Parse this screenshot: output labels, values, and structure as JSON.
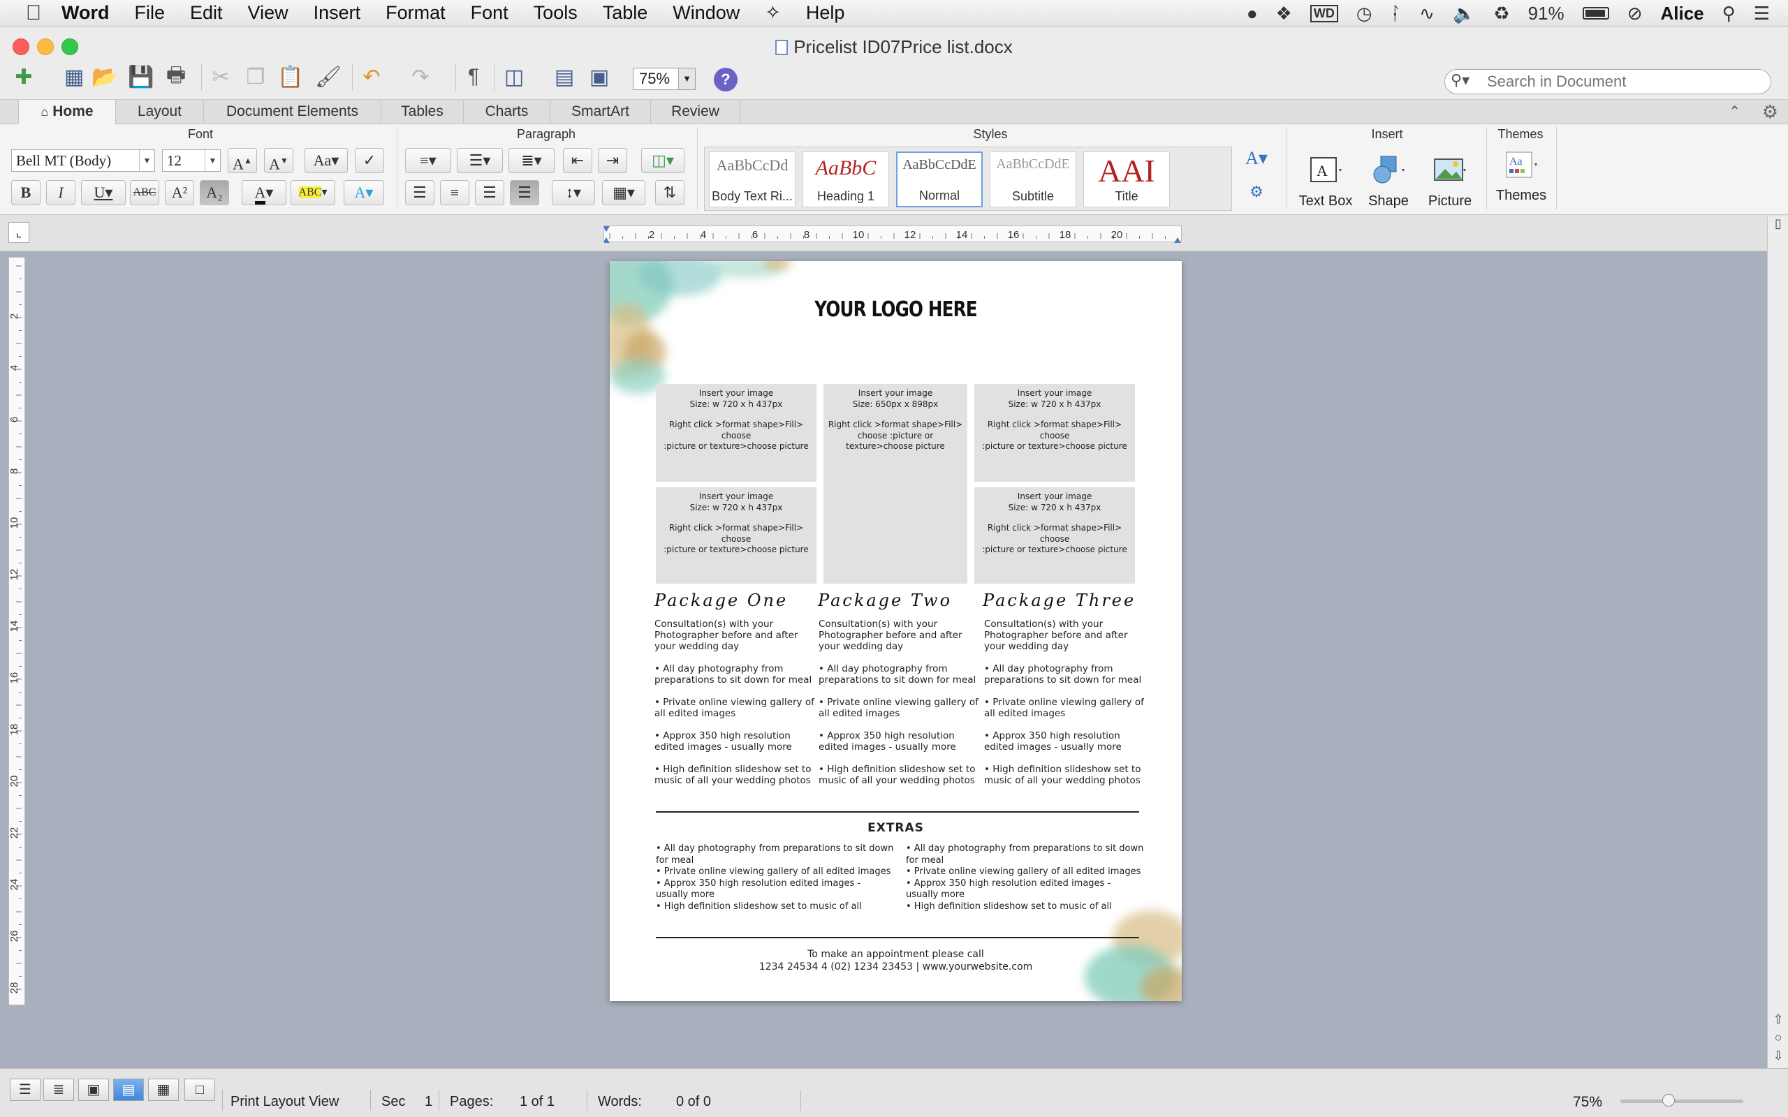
{
  "menubar": {
    "items": [
      "Word",
      "File",
      "Edit",
      "View",
      "Insert",
      "Format",
      "Font",
      "Tools",
      "Table",
      "Window",
      "Help"
    ],
    "battery": "91%",
    "user": "Alice"
  },
  "window": {
    "title": "Pricelist ID07Price list.docx"
  },
  "toolbar": {
    "zoom": "75%",
    "search_placeholder": "Search in Document"
  },
  "ribbon": {
    "tabs": [
      "Home",
      "Layout",
      "Document Elements",
      "Tables",
      "Charts",
      "SmartArt",
      "Review"
    ],
    "groups": {
      "font": "Font",
      "paragraph": "Paragraph",
      "styles": "Styles",
      "insert": "Insert",
      "themes": "Themes"
    },
    "font_name": "Bell MT (Body)",
    "font_size": "12",
    "styles": [
      {
        "sample": "AaBbCcDd",
        "name": "Body Text Ri..."
      },
      {
        "sample": "AaBbC",
        "name": "Heading 1"
      },
      {
        "sample": "AaBbCcDdE",
        "name": "Normal"
      },
      {
        "sample": "AaBbCcDdE",
        "name": "Subtitle"
      },
      {
        "sample": "AAI",
        "name": "Title"
      }
    ],
    "insert_buttons": [
      "Text Box",
      "Shape",
      "Picture"
    ],
    "themes_button": "Themes"
  },
  "ruler": {
    "h_labels": [
      "2",
      "4",
      "6",
      "8",
      "10",
      "12",
      "14",
      "16",
      "18",
      "20"
    ],
    "v_labels": [
      "2",
      "4",
      "6",
      "8",
      "10",
      "12",
      "14",
      "16",
      "18",
      "20",
      "22",
      "24",
      "26",
      "28"
    ]
  },
  "document": {
    "logo": "YOUR LOGO HERE",
    "placeholders": [
      {
        "l1": "Insert your image",
        "l2": "Size: w 720 x h 437px",
        "l3": "Right click >format shape>Fill> choose",
        "l4": ":picture or texture>choose picture"
      },
      {
        "l1": "Insert your image",
        "l2": "Size: 650px x 898px",
        "l3": "Right click >format shape>Fill> choose :picture or texture>choose picture",
        "l4": ""
      },
      {
        "l1": "Insert your image",
        "l2": "Size: w 720 x h 437px",
        "l3": "Right click >format shape>Fill> choose",
        "l4": ":picture or texture>choose picture"
      },
      {
        "l1": "Insert your image",
        "l2": "Size: w 720 x h 437px",
        "l3": "Right click >format shape>Fill> choose",
        "l4": ":picture or texture>choose picture"
      },
      {
        "l1": "Insert your image",
        "l2": "Size: w 720 x h 437px",
        "l3": "Right click >format shape>Fill> choose",
        "l4": ":picture or texture>choose picture"
      }
    ],
    "packages": [
      {
        "title": "Package One",
        "intro": "Consultation(s) with your Photographer before and after your wedding day",
        "bullets": [
          "• All day photography from preparations to sit down for meal",
          "• Private online viewing gallery of all edited images",
          "• Approx 350 high resolution edited images - usually more",
          "• High definition slideshow set to music of all your wedding photos"
        ]
      },
      {
        "title": "Package Two",
        "intro": "Consultation(s) with your Photographer before and after your wedding day",
        "bullets": [
          "• All day photography from preparations to sit down for meal",
          "• Private online viewing gallery of all edited images",
          "• Approx 350 high resolution edited images - usually more",
          "• High definition slideshow set to music of all your wedding photos"
        ]
      },
      {
        "title": "Package Three",
        "intro": "Consultation(s) with your Photographer before and after your wedding day",
        "bullets": [
          "• All day photography from preparations to sit down for meal",
          "• Private online viewing gallery of all edited images",
          "• Approx 350 high resolution edited images - usually more",
          "• High definition slideshow set to music of all your wedding photos"
        ]
      }
    ],
    "extras_title": "EXTRAS",
    "extras": [
      [
        "• All day photography from preparations to sit down for meal",
        "• Private online viewing gallery of all edited images",
        "• Approx 350 high resolution edited images - usually more",
        "• High definition slideshow set to music of all"
      ],
      [
        "• All day photography from preparations to sit down for meal",
        "• Private online viewing gallery of all edited images",
        "• Approx 350 high resolution edited images - usually more",
        "• High definition slideshow set to music of all"
      ]
    ],
    "footer_line1": "To make an appointment please call",
    "footer_line2": "1234 24534 4 (02) 1234 23453 | www.yourwebsite.com"
  },
  "statusbar": {
    "view": "Print Layout View",
    "sec_label": "Sec",
    "sec_value": "1",
    "pages_label": "Pages:",
    "pages_value": "1 of 1",
    "words_label": "Words:",
    "words_value": "0 of 0",
    "zoom": "75%"
  },
  "colors": {
    "accent_teal": "#7fcbb9",
    "accent_gold": "#c9a765",
    "active_view": "#3f86de"
  }
}
